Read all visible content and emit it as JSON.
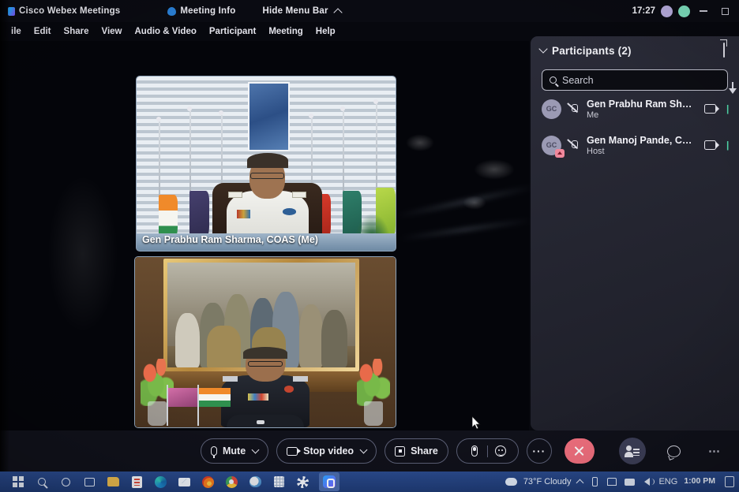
{
  "app": {
    "title": "Cisco Webex Meetings",
    "meeting_info_label": "Meeting Info",
    "hide_menu_label": "Hide Menu Bar",
    "clock": "17:27"
  },
  "menubar": {
    "items": [
      {
        "label": "ile"
      },
      {
        "label": "Edit"
      },
      {
        "label": "Share"
      },
      {
        "label": "View"
      },
      {
        "label": "Audio & Video"
      },
      {
        "label": "Participant"
      },
      {
        "label": "Meeting"
      },
      {
        "label": "Help"
      }
    ]
  },
  "stage": {
    "tiles": [
      {
        "name": "Gen Prabhu Ram Sharma, COAS (Me)"
      },
      {
        "name": ""
      }
    ]
  },
  "panel": {
    "title": "Participants (2)",
    "search": {
      "placeholder": "Search",
      "value": ""
    },
    "participants": [
      {
        "initials": "GC",
        "name": "Gen Prabhu Ram Sharm...",
        "role": "Me",
        "host": false
      },
      {
        "initials": "GC",
        "name": "Gen Manoj Pande, COAS",
        "role": "Host",
        "host": true
      }
    ]
  },
  "controls": {
    "mute_label": "Mute",
    "video_label": "Stop video",
    "share_label": "Share",
    "more_label": "···"
  },
  "taskbar": {
    "weather": "73°F  Cloudy",
    "language": "ENG",
    "time": "1:00 PM",
    "date": ""
  },
  "colors": {
    "accent": "#2aa6ff",
    "leave_red": "#f2707f",
    "panel_bg": "#262732",
    "taskbar_blue": "#2a4a8c"
  }
}
